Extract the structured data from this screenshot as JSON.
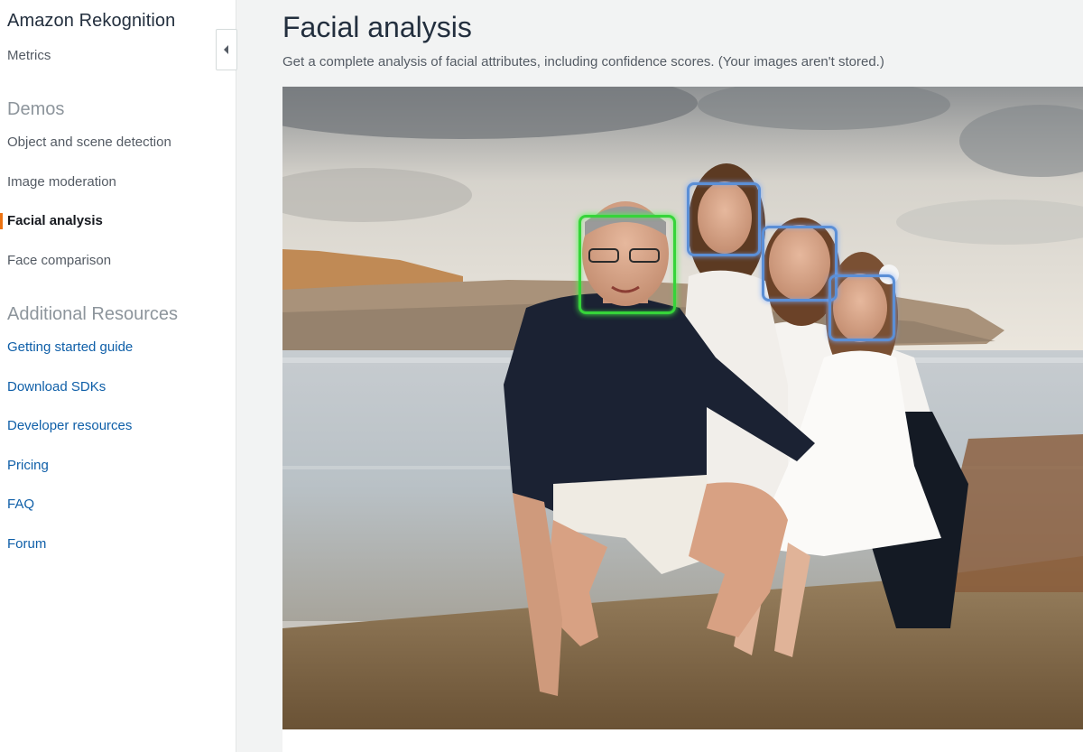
{
  "sidebar": {
    "title": "Amazon Rekognition",
    "metrics": "Metrics",
    "demos_heading": "Demos",
    "demos": [
      {
        "label": "Object and scene detection"
      },
      {
        "label": "Image moderation"
      },
      {
        "label": "Facial analysis"
      },
      {
        "label": "Face comparison"
      }
    ],
    "resources_heading": "Additional Resources",
    "resources": [
      {
        "label": "Getting started guide"
      },
      {
        "label": "Download SDKs"
      },
      {
        "label": "Developer resources"
      },
      {
        "label": "Pricing"
      },
      {
        "label": "FAQ"
      },
      {
        "label": "Forum"
      }
    ]
  },
  "main": {
    "title": "Facial analysis",
    "subtitle": "Get a complete analysis of facial attributes, including confidence scores. (Your images aren't stored.)"
  },
  "icons": {
    "collapse": "chevron-left-icon"
  },
  "colors": {
    "active_accent": "#ec7211",
    "selected_face": "#36d43a",
    "face_box": "#5b8fd6",
    "link_blue": "#0f5fa8"
  }
}
